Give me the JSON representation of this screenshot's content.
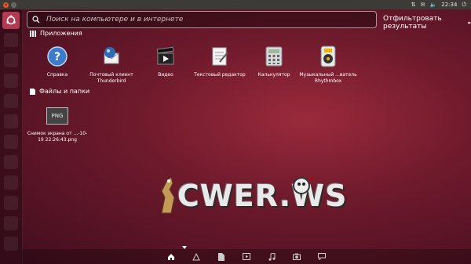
{
  "topbar": {
    "time": "22:34"
  },
  "search": {
    "placeholder": "Поиск на компьютере и в интернете"
  },
  "filter_label": "Отфильтровать результаты",
  "sections": {
    "apps": {
      "title": "Приложения"
    },
    "files": {
      "title": "Файлы и папки"
    }
  },
  "apps": [
    {
      "label": "Справка",
      "icon": "help-icon"
    },
    {
      "label": "Почтовый клиент Thunderbird",
      "icon": "thunderbird-icon"
    },
    {
      "label": "Видео",
      "icon": "video-icon"
    },
    {
      "label": "Текстовый редактор",
      "icon": "text-editor-icon"
    },
    {
      "label": "Калькулятор",
      "icon": "calculator-icon"
    },
    {
      "label": "Музыкальный ...ватель Rhythmbox",
      "icon": "rhythmbox-icon"
    }
  ],
  "files": [
    {
      "label": "Снимок экрана от ...-10-19 22:26:43.png",
      "badge": "PNG",
      "icon": "png-file-icon"
    }
  ],
  "watermark": {
    "text": "CWER.WS"
  },
  "colors": {
    "accent": "#b33a52",
    "topbar": "#3c3b37"
  }
}
